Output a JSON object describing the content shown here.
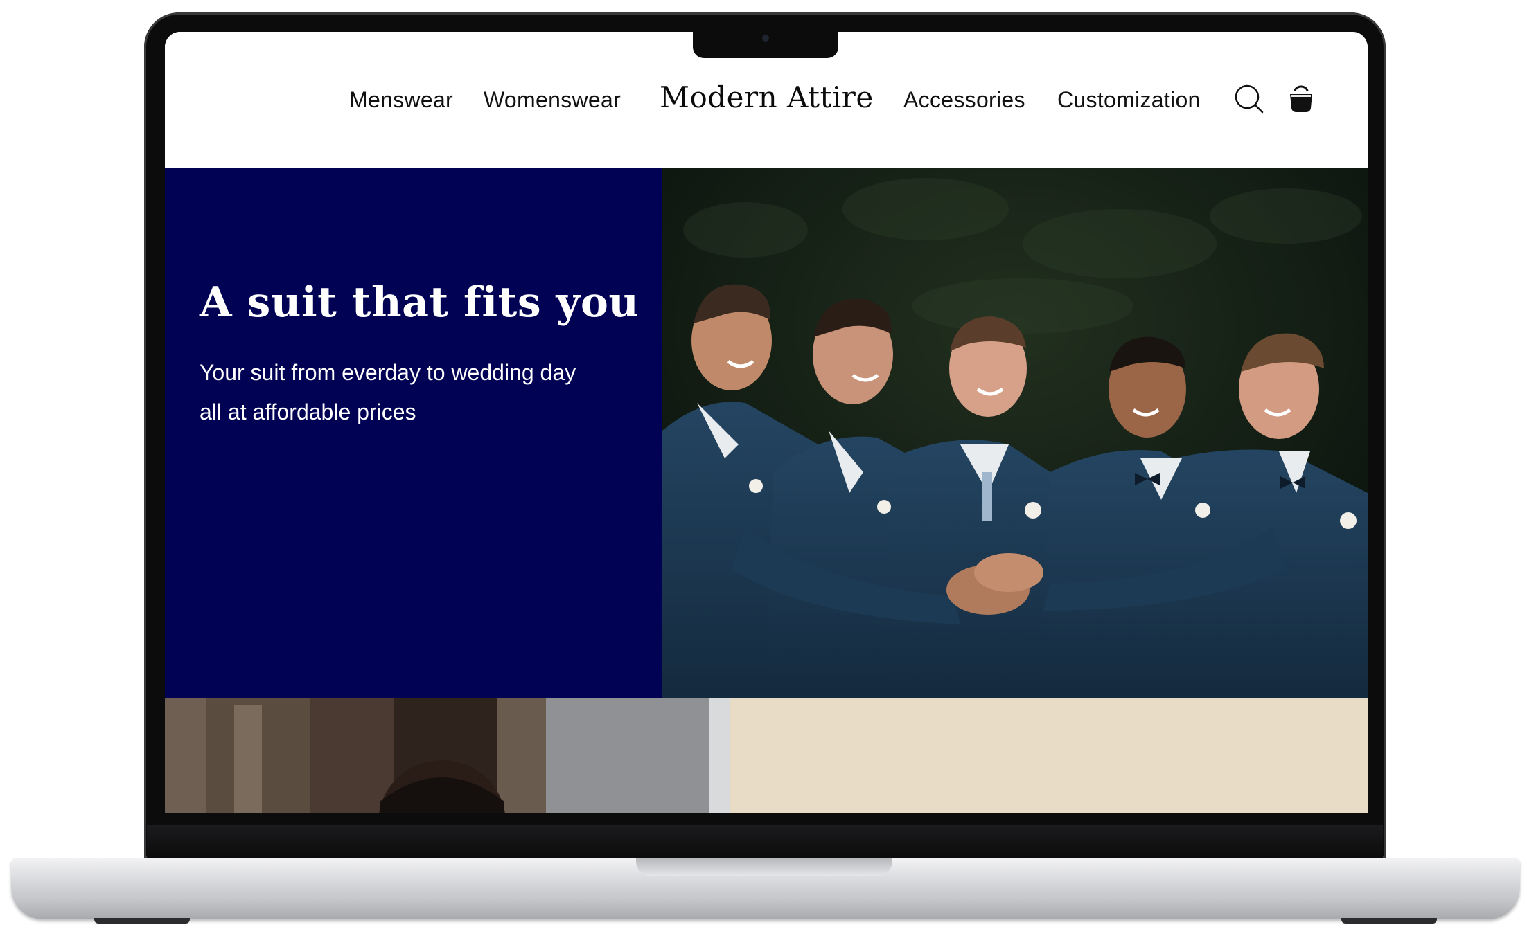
{
  "nav": {
    "left": [
      "Menswear",
      "Womenswear"
    ],
    "right": [
      "Accessories",
      "Customization"
    ],
    "brand": "Modern Attire",
    "icons": [
      "search-icon",
      "shopping-bag-icon"
    ]
  },
  "hero": {
    "title": "A suit that fits you",
    "subtitle": "Your suit from everday to wedding day all at affordable prices",
    "image_icon": "groomsmen-photo"
  },
  "colors": {
    "hero_panel": "#010254",
    "cream_panel": "#e8dcc6",
    "suit_navy": "#1f3a52",
    "text_dark": "#111111"
  }
}
